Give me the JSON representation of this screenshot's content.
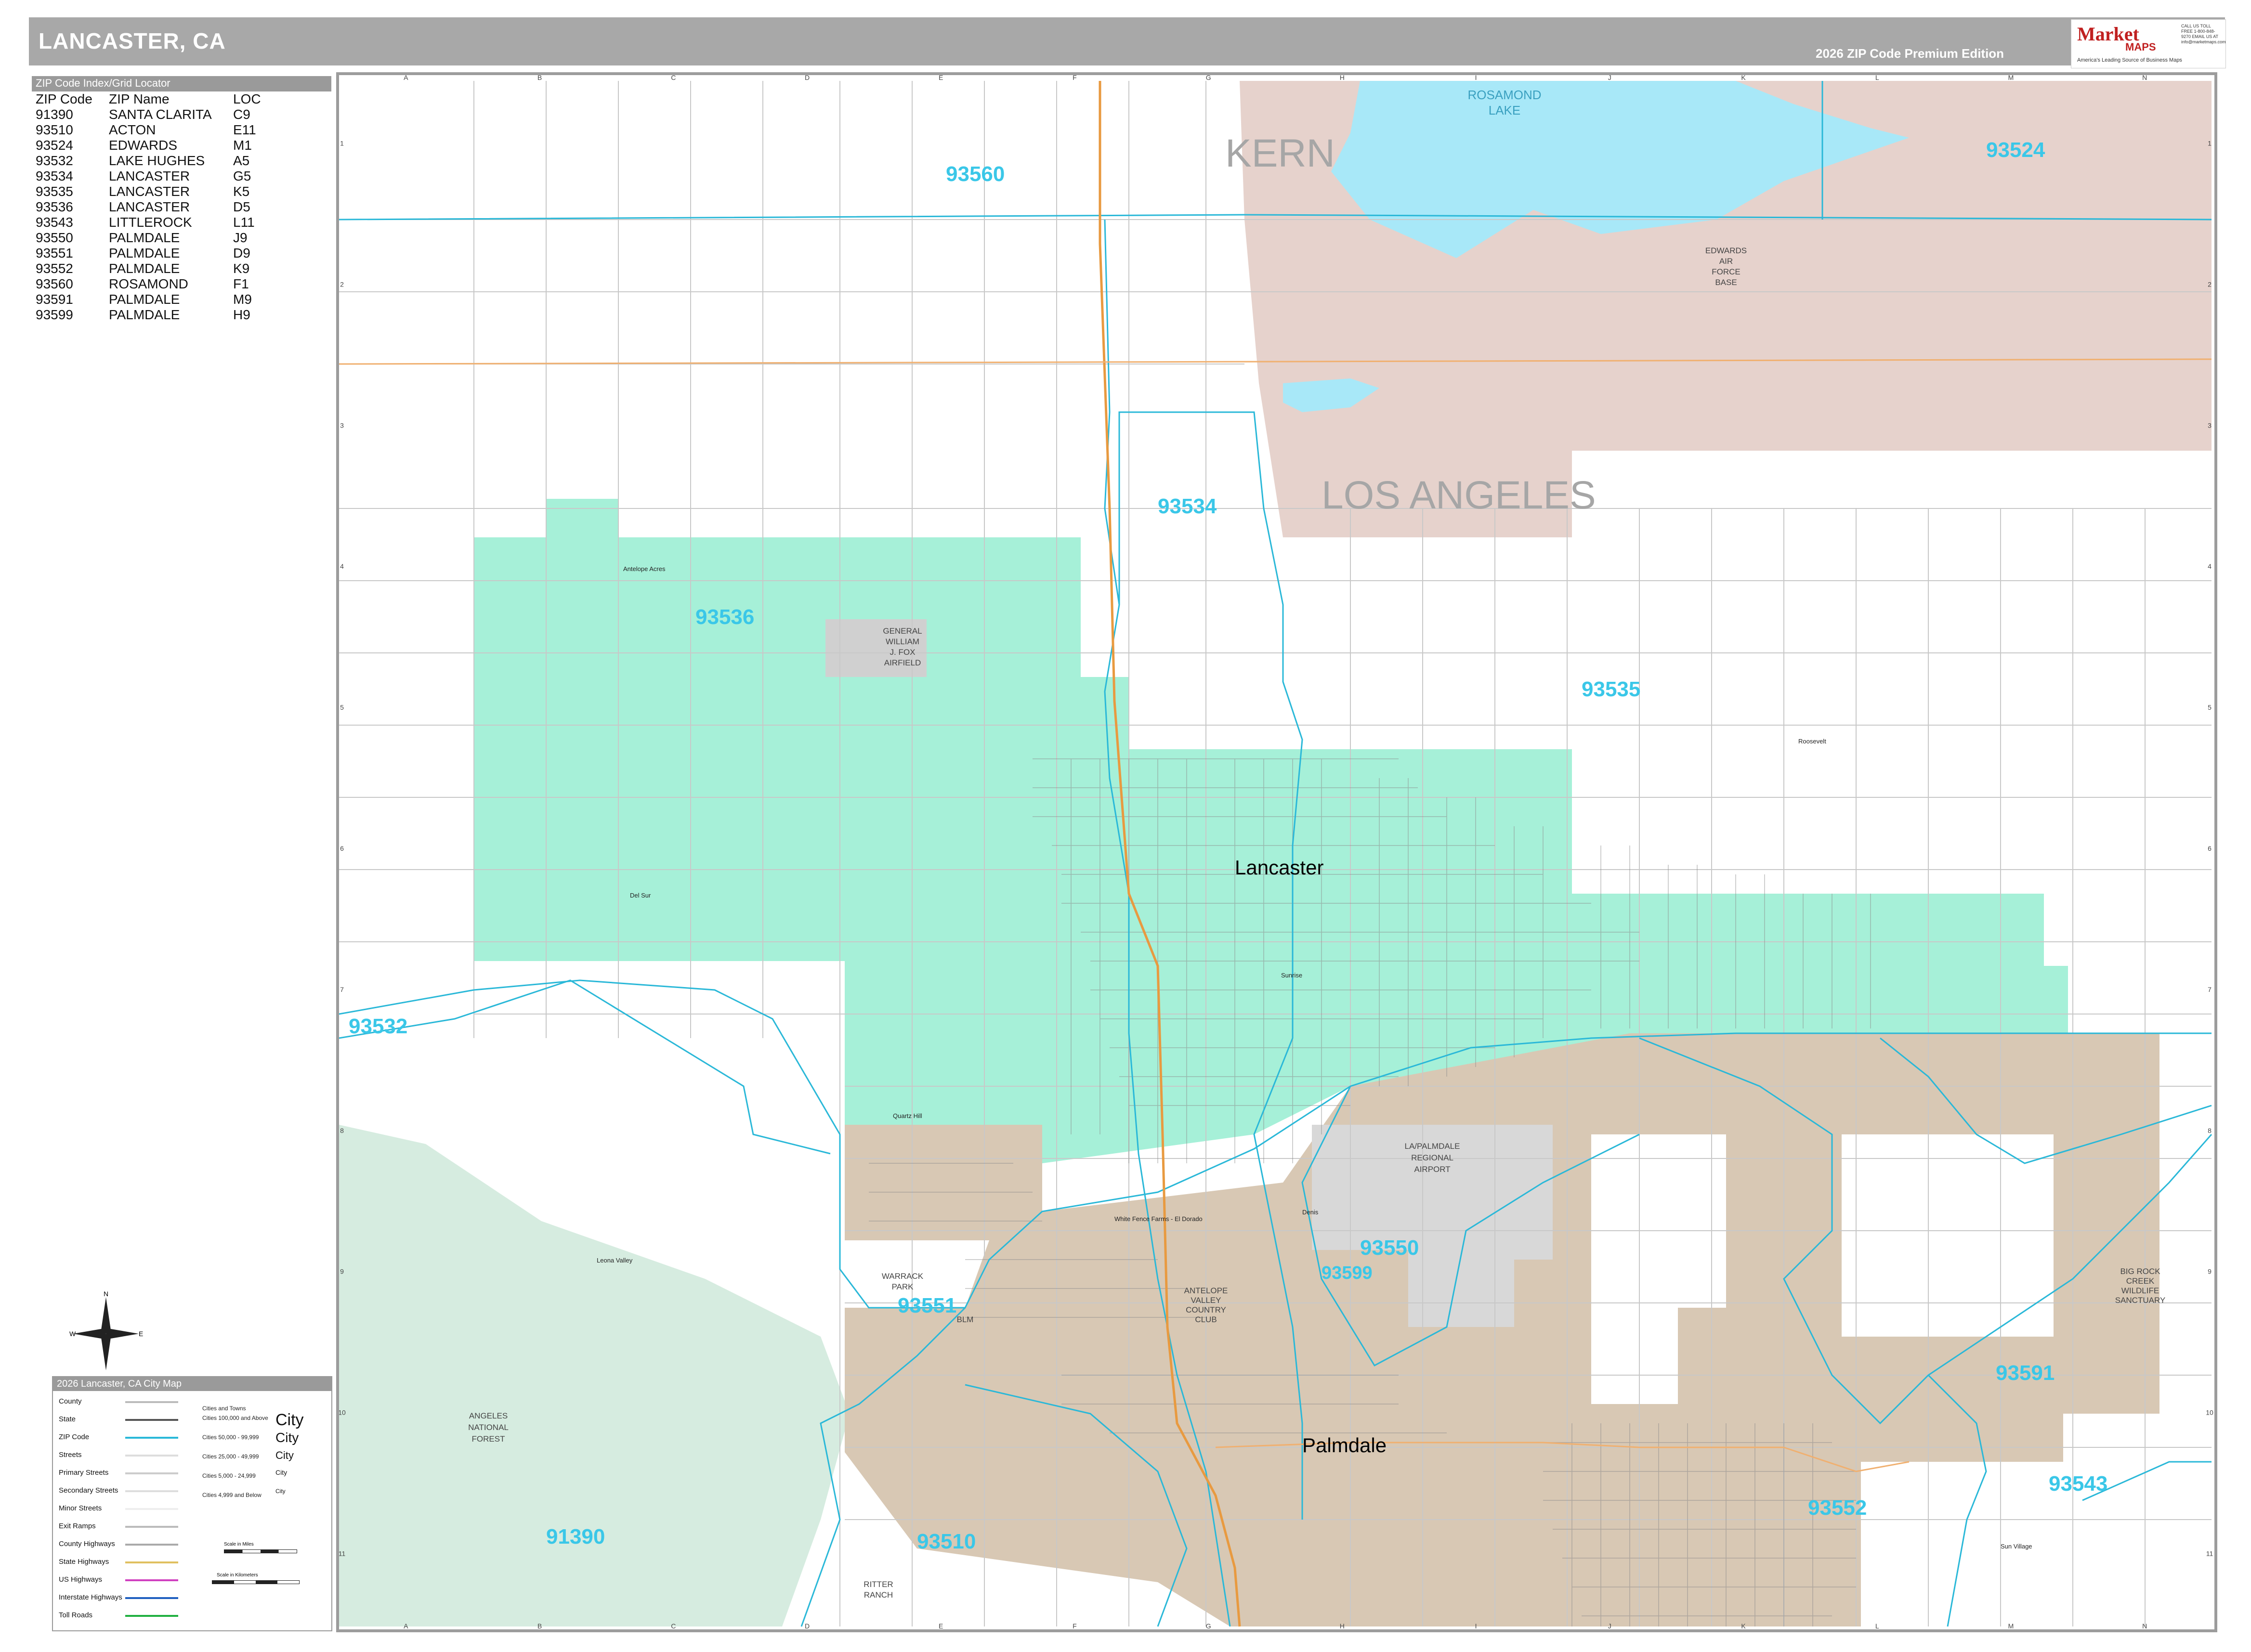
{
  "header": {
    "title": "LANCASTER, CA",
    "edition": "2026 ZIP Code Premium Edition"
  },
  "logo": {
    "brand": "Market",
    "maps": "MAPS",
    "tagline": "America's Leading Source of Business Maps",
    "contact": "CALL US TOLL FREE 1-800-848-9270 EMAIL US AT info@marketmaps.com"
  },
  "zip_index": {
    "heading": "ZIP Code Index/Grid Locator",
    "columns": [
      "ZIP Code",
      "ZIP Name",
      "LOC"
    ],
    "rows": [
      [
        "91390",
        "SANTA CLARITA",
        "C9"
      ],
      [
        "93510",
        "ACTON",
        "E11"
      ],
      [
        "93524",
        "EDWARDS",
        "M1"
      ],
      [
        "93532",
        "LAKE HUGHES",
        "A5"
      ],
      [
        "93534",
        "LANCASTER",
        "G5"
      ],
      [
        "93535",
        "LANCASTER",
        "K5"
      ],
      [
        "93536",
        "LANCASTER",
        "D5"
      ],
      [
        "93543",
        "LITTLEROCK",
        "L11"
      ],
      [
        "93550",
        "PALMDALE",
        "J9"
      ],
      [
        "93551",
        "PALMDALE",
        "D9"
      ],
      [
        "93552",
        "PALMDALE",
        "K9"
      ],
      [
        "93560",
        "ROSAMOND",
        "F1"
      ],
      [
        "93591",
        "PALMDALE",
        "M9"
      ],
      [
        "93599",
        "PALMDALE",
        "H9"
      ]
    ]
  },
  "map": {
    "grid_columns": [
      "A",
      "B",
      "C",
      "D",
      "E",
      "F",
      "G",
      "H",
      "I",
      "J",
      "K",
      "L",
      "M",
      "N"
    ],
    "grid_rows": [
      "1",
      "2",
      "3",
      "4",
      "5",
      "6",
      "7",
      "8",
      "9",
      "10",
      "11"
    ],
    "counties": [
      "KERN",
      "LOS ANGELES"
    ],
    "cities": [
      "Lancaster",
      "Palmdale"
    ],
    "water_labels": [
      "ROSAMOND",
      "LAKE"
    ],
    "zip_labels": [
      "93560",
      "93524",
      "93534",
      "93536",
      "93535",
      "93532",
      "93550",
      "93599",
      "93551",
      "93591",
      "91390",
      "93510",
      "93552",
      "93543"
    ],
    "place_labels": {
      "edwards": [
        "EDWARDS",
        "AIR",
        "FORCE",
        "BASE"
      ],
      "airfield": [
        "GENERAL",
        "WILLIAM",
        "J. FOX",
        "AIRFIELD"
      ],
      "airport": [
        "LA/PALMDALE",
        "REGIONAL",
        "AIRPORT"
      ],
      "forest": [
        "ANGELES",
        "NATIONAL",
        "FOREST"
      ],
      "warrack": [
        "WARRACK",
        "PARK"
      ],
      "blm": "BLM",
      "ritter": [
        "RITTER",
        "RANCH"
      ],
      "country_club": [
        "ANTELOPE",
        "VALLEY",
        "COUNTRY",
        "CLUB"
      ],
      "big_rock": [
        "BIG ROCK",
        "CREEK",
        "WILDLIFE",
        "SANCTUARY"
      ],
      "antelope_acres": "Antelope Acres",
      "del_sur": "Del Sur",
      "quartz_hill": "Quartz Hill",
      "leona_valley": "Leona Valley",
      "white_fence": "White Fence Farms - El Dorado",
      "sun_village": "Sun Village",
      "roosevelt": "Roosevelt",
      "sunrise": "Sunrise",
      "denis": "Denis"
    }
  },
  "legend": {
    "heading": "2026 Lancaster, CA City Map",
    "items": [
      "County",
      "State",
      "ZIP Code",
      "Streets",
      "Primary Streets",
      "Secondary Streets",
      "Minor Streets",
      "Exit Ramps",
      "County Highways",
      "State Highways",
      "US Highways",
      "Interstate Highways",
      "Toll Roads"
    ],
    "cities_heading": "Cities and Towns",
    "city_sizes": [
      "Cities 100,000 and Above",
      "Cities 50,000 - 99,999",
      "Cities 25,000 - 49,999",
      "Cities 5,000 - 24,999",
      "Cities 4,999 and Below"
    ],
    "city_samples": [
      "City",
      "City",
      "City",
      "City",
      "City"
    ],
    "scale_miles": "Scale in Miles",
    "scale_km": "Scale in Kilometers"
  },
  "compass": {
    "n": "N",
    "s": "S",
    "e": "E",
    "w": "W"
  },
  "colors": {
    "zip_boundary": "#2ab8d8",
    "zip_label": "#3ac7e8",
    "lancaster_fill": "#a6f0d8",
    "palmdale_fill": "#d8c8b4",
    "kern_fill": "#e6d2cc",
    "water": "#a8e8f8",
    "forest": "#d6ece0",
    "airport": "#d8d8d8",
    "highway": "#e89a40"
  }
}
